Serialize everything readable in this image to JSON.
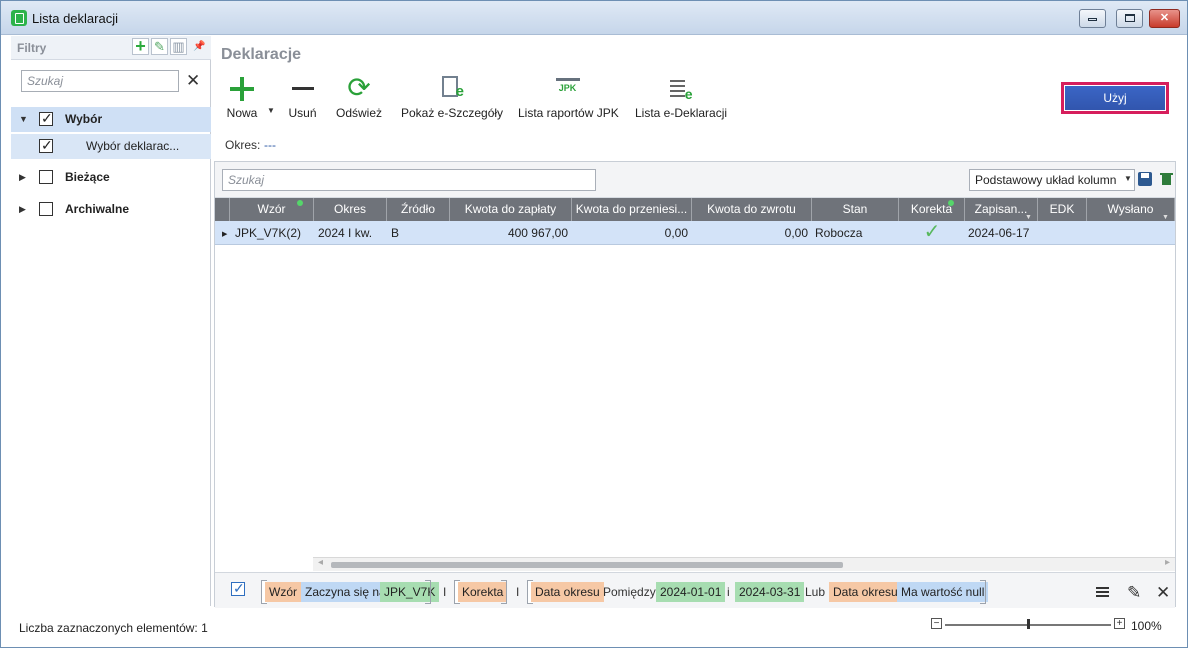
{
  "window": {
    "title": "Lista deklaracji"
  },
  "sidebar": {
    "title": "Filtry",
    "search_placeholder": "Szukaj",
    "items": [
      {
        "label": "Wybór"
      },
      {
        "label": "Wybór deklarac..."
      },
      {
        "label": "Bieżące"
      },
      {
        "label": "Archiwalne"
      }
    ]
  },
  "main": {
    "title": "Deklaracje",
    "toolbar": [
      {
        "label": "Nowa"
      },
      {
        "label": "Usuń"
      },
      {
        "label": "Odśwież"
      },
      {
        "label": "Pokaż e-Szczegóły"
      },
      {
        "label": "Lista raportów JPK"
      },
      {
        "label": "Lista e-Deklaracji"
      }
    ],
    "use_button": "Użyj",
    "period_label": "Okres:",
    "period_value": "---",
    "grid": {
      "search_placeholder": "Szukaj",
      "layout": "Podstawowy układ kolumn",
      "columns": [
        "Wzór",
        "Okres",
        "Źródło",
        "Kwota do zapłaty",
        "Kwota do przeniesi...",
        "Kwota do zwrotu",
        "Stan",
        "Korekta",
        "Zapisan...",
        "EDK",
        "Wysłano"
      ],
      "rows": [
        {
          "wzor": "JPK_V7K(2)",
          "okres": "2024 I kw.",
          "zrodlo": "B",
          "kwota_do_zaplaty": "400 967,00",
          "kwota_do_przeniesienia": "0,00",
          "kwota_do_zwrotu": "0,00",
          "stan": "Robocza",
          "korekta": "✓",
          "zapisano": "2024-06-17",
          "edk": "",
          "wyslano": ""
        }
      ]
    },
    "filter_bar": {
      "parts": [
        "Wzór",
        "Zaczyna się na",
        "JPK_V7K",
        "I",
        "Korekta",
        "I",
        "Data okresu",
        "Pomiędzy",
        "2024-01-01",
        "i",
        "2024-03-31",
        "Lub",
        "Data okresu",
        "Ma wartość null"
      ]
    }
  },
  "status": {
    "selected_count": "Liczba zaznaczonych elementów: 1",
    "zoom": "100%",
    "zoom_fraction": 0.5
  }
}
